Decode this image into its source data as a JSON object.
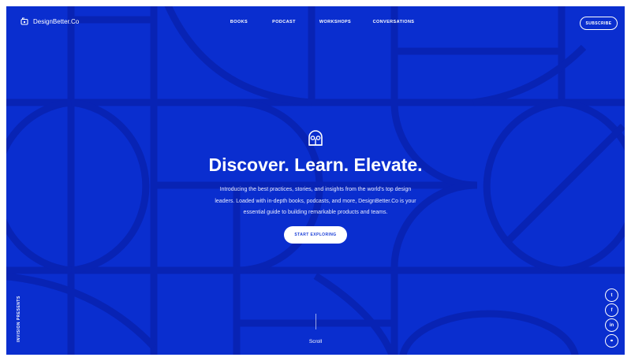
{
  "brand": {
    "name": "DesignBetter.Co",
    "logo_icon": "mailbox-icon"
  },
  "nav": {
    "items": [
      "BOOKS",
      "PODCAST",
      "WORKSHOPS",
      "CONVERSATIONS"
    ]
  },
  "header": {
    "subscribe_label": "SUBSCRIBE"
  },
  "hero": {
    "icon": "book-owl-icon",
    "headline": "Discover. Learn. Elevate.",
    "intro": "Introducing the best practices, stories, and insights from the world's top design leaders. Loaded with in-depth books, podcasts, and more, DesignBetter.Co is your essential guide to building remarkable products and teams.",
    "cta_label": "START EXPLORING"
  },
  "side": {
    "invision_label": "INVISION PRESENTS"
  },
  "scroll": {
    "label": "Scroll"
  },
  "social": [
    {
      "name": "twitter-icon",
      "glyph": "t"
    },
    {
      "name": "facebook-icon",
      "glyph": "f"
    },
    {
      "name": "linkedin-icon",
      "glyph": "in"
    },
    {
      "name": "link-icon",
      "glyph": "⚭"
    }
  ],
  "colors": {
    "background": "#0a2ecf",
    "pattern": "#0823b4",
    "text": "#ffffff",
    "button_text": "#1a3fd8"
  }
}
